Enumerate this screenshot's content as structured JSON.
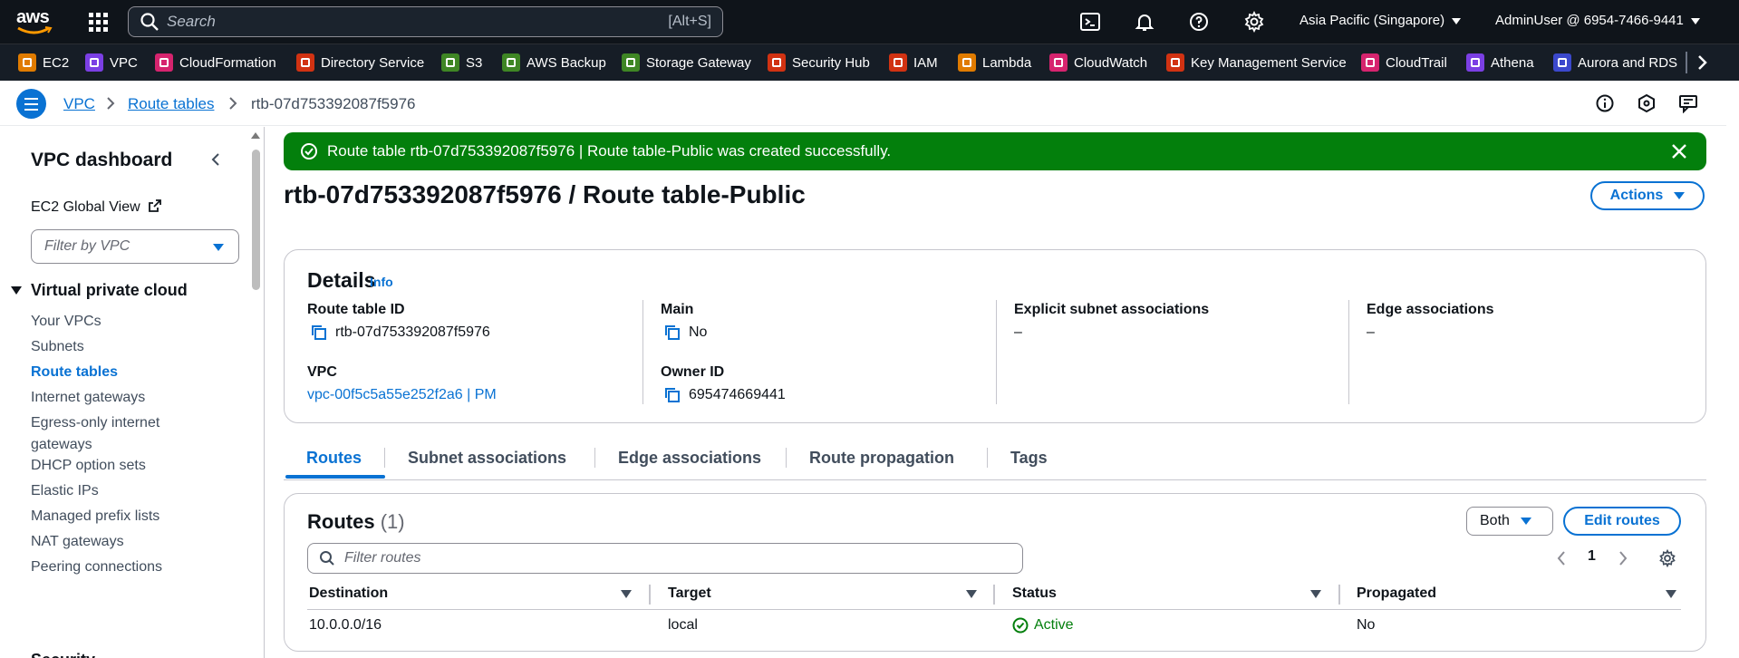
{
  "topnav": {
    "search_placeholder": "Search",
    "search_shortcut": "[Alt+S]",
    "region": "Asia Pacific (Singapore)",
    "user": "AdminUser @ 6954-7466-9441",
    "logo_text": "aws"
  },
  "favorites": [
    {
      "label": "EC2",
      "color": "#e07b00"
    },
    {
      "label": "VPC",
      "color": "#7b3fe4"
    },
    {
      "label": "CloudFormation",
      "color": "#d6246e"
    },
    {
      "label": "Directory Service",
      "color": "#d13212"
    },
    {
      "label": "S3",
      "color": "#3f8624"
    },
    {
      "label": "AWS Backup",
      "color": "#3f8624"
    },
    {
      "label": "Storage Gateway",
      "color": "#3f8624"
    },
    {
      "label": "Security Hub",
      "color": "#d13212"
    },
    {
      "label": "IAM",
      "color": "#d13212"
    },
    {
      "label": "Lambda",
      "color": "#e07b00"
    },
    {
      "label": "CloudWatch",
      "color": "#d6246e"
    },
    {
      "label": "Key Management Service",
      "color": "#d13212"
    },
    {
      "label": "CloudTrail",
      "color": "#d6246e"
    },
    {
      "label": "Athena",
      "color": "#7b3fe4"
    },
    {
      "label": "Aurora and RDS",
      "color": "#3b48cc"
    }
  ],
  "breadcrumb": {
    "items": [
      "VPC",
      "Route tables"
    ],
    "current": "rtb-07d753392087f5976"
  },
  "sidebar": {
    "title": "VPC dashboard",
    "global_view": "EC2 Global View",
    "filter_placeholder": "Filter by VPC",
    "section": "Virtual private cloud",
    "items": [
      {
        "label": "Your VPCs"
      },
      {
        "label": "Subnets"
      },
      {
        "label": "Route tables"
      },
      {
        "label": "Internet gateways"
      },
      {
        "label": "Egress-only internet gateways"
      },
      {
        "label": "DHCP option sets"
      },
      {
        "label": "Elastic IPs"
      },
      {
        "label": "Managed prefix lists"
      },
      {
        "label": "NAT gateways"
      },
      {
        "label": "Peering connections"
      }
    ],
    "next_section_partial": "Security"
  },
  "flash": {
    "message": "Route table rtb-07d753392087f5976 | Route table-Public was created successfully."
  },
  "page": {
    "title": "rtb-07d753392087f5976 / Route table-Public",
    "actions_label": "Actions"
  },
  "details": {
    "heading": "Details",
    "info": "Info",
    "route_table_id_label": "Route table ID",
    "route_table_id": "rtb-07d753392087f5976",
    "main_label": "Main",
    "main": "No",
    "explicit_label": "Explicit subnet associations",
    "explicit": "–",
    "edge_label": "Edge associations",
    "edge": "–",
    "vpc_label": "VPC",
    "vpc": "vpc-00f5c5a55e252f2a6 | PM",
    "owner_label": "Owner ID",
    "owner": "695474669441"
  },
  "tabs": [
    "Routes",
    "Subnet associations",
    "Edge associations",
    "Route propagation",
    "Tags"
  ],
  "routes": {
    "heading": "Routes",
    "count": "(1)",
    "both_label": "Both",
    "edit_label": "Edit routes",
    "filter_placeholder": "Filter routes",
    "page": "1",
    "columns": [
      "Destination",
      "Target",
      "Status",
      "Propagated"
    ],
    "rows": [
      {
        "destination": "10.0.0.0/16",
        "target": "local",
        "status": "Active",
        "propagated": "No"
      }
    ]
  }
}
